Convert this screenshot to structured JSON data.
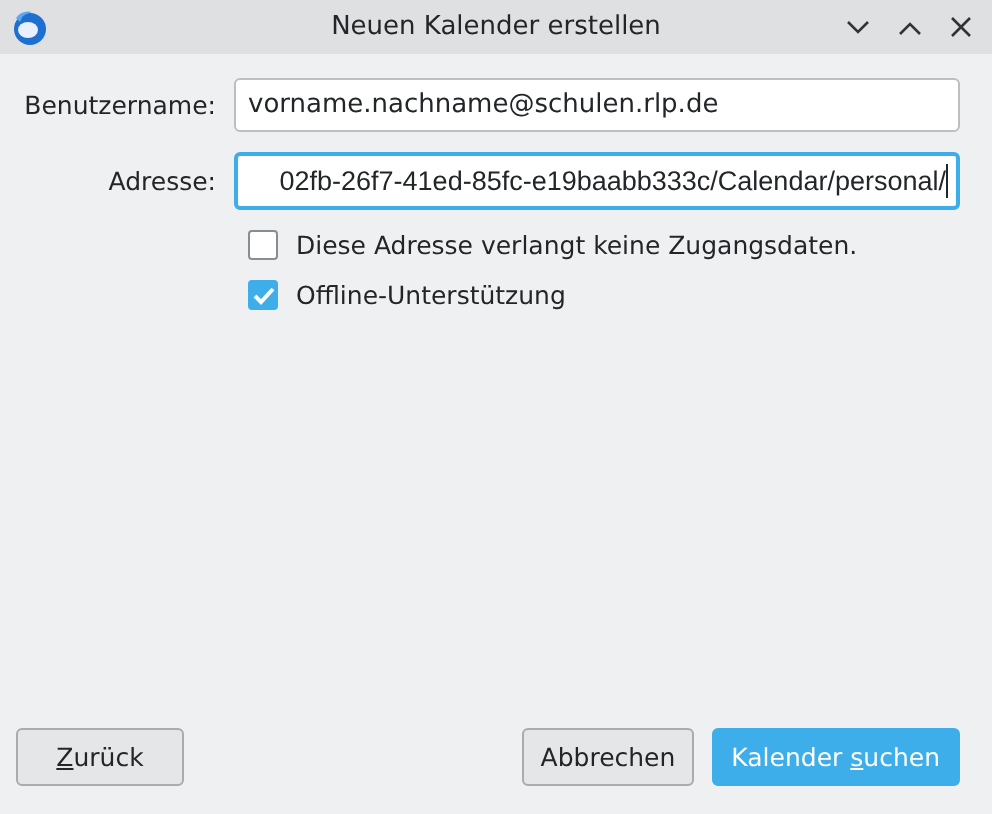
{
  "window": {
    "title": "Neuen Kalender erstellen"
  },
  "fields": [
    {
      "label": "Benutzername:",
      "value": "vorname.nachname@schulen.rlp.de",
      "focused": false
    },
    {
      "label": "Adresse:",
      "value": "02fb-26f7-41ed-85fc-e19baabb333c/Calendar/personal/",
      "focused": true
    }
  ],
  "checkboxes": [
    {
      "label": "Diese Adresse verlangt keine Zugangsdaten.",
      "checked": false
    },
    {
      "label": "Offline-Unterstützung",
      "checked": true
    }
  ],
  "buttons": [
    {
      "key": "Z",
      "post": "urück",
      "primary": false
    },
    {
      "pre": "Abbrechen",
      "primary": false
    },
    {
      "pre": "Kalender ",
      "key": "s",
      "post": "uchen",
      "primary": true
    }
  ]
}
